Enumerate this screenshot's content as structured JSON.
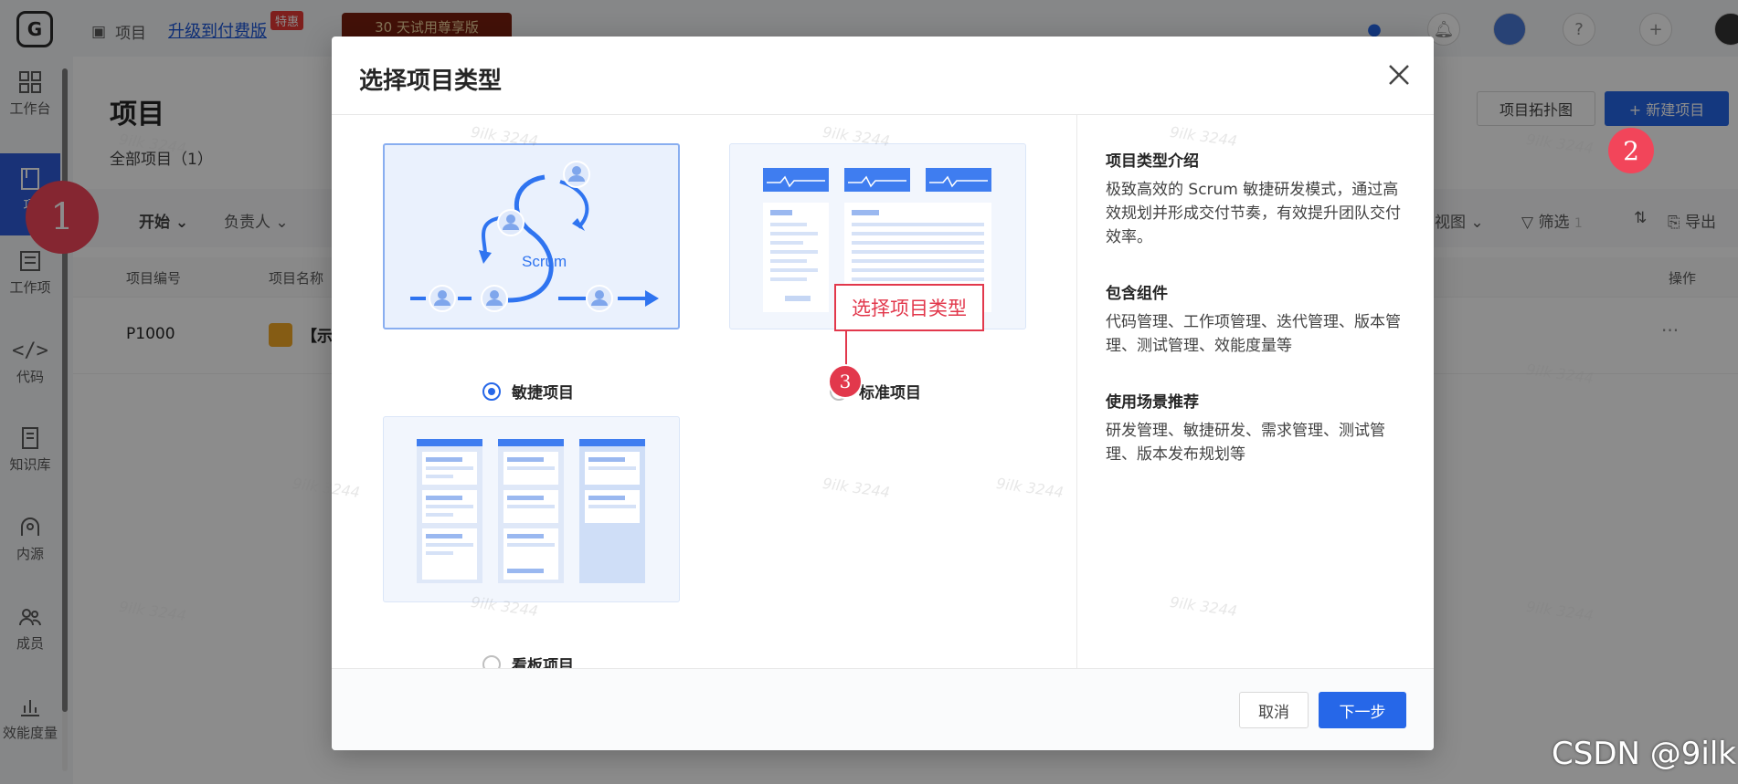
{
  "topbar": {
    "logo": "G",
    "breadcrumb": "项目",
    "upgrade_link": "升级到付费版",
    "special_badge": "特惠",
    "trial_banner": "30 天试用尊享版"
  },
  "sidebar": {
    "items": [
      {
        "label": "工作台",
        "icon": "grid-icon"
      },
      {
        "label": "项",
        "icon": "book-icon"
      },
      {
        "label": "工作项",
        "icon": "list-icon"
      },
      {
        "label": "代码",
        "icon": "code-icon"
      },
      {
        "label": "知识库",
        "icon": "doc-icon"
      },
      {
        "label": "内源",
        "icon": "source-icon"
      },
      {
        "label": "成员",
        "icon": "members-icon"
      },
      {
        "label": "效能度量",
        "icon": "chart-icon"
      }
    ]
  },
  "main": {
    "title": "项目",
    "all_projects": "全部项目（1）",
    "topology_button": "项目拓扑图",
    "new_project_button": "+ 新建项目",
    "filters": {
      "start": "开始",
      "owner": "负责人",
      "view": "视图",
      "filter": "筛选",
      "filter_count": "1",
      "export": "导出"
    },
    "columns": [
      "项目编号",
      "项目名称",
      "操作"
    ],
    "rows": [
      {
        "id": "P1000",
        "name": "【示"
      }
    ]
  },
  "modal": {
    "title": "选择项目类型",
    "options": [
      {
        "label": "敏捷项目",
        "checked": true,
        "illustration": "Scrum"
      },
      {
        "label": "标准项目",
        "checked": false
      },
      {
        "label": "看板项目",
        "checked": false
      }
    ],
    "sections": [
      {
        "title": "项目类型介绍",
        "text": "极致高效的 Scrum 敏捷研发模式，通过高效规划并形成交付节奏，有效提升团队交付效率。"
      },
      {
        "title": "包含组件",
        "text": "代码管理、工作项管理、迭代管理、版本管理、测试管理、效能度量等"
      },
      {
        "title": "使用场景推荐",
        "text": "研发管理、敏捷研发、需求管理、测试管理、版本发布规划等"
      }
    ],
    "cancel_button": "取消",
    "next_button": "下一步"
  },
  "annotations": {
    "step1": "1",
    "step2": "2",
    "step3": "3",
    "callout": "选择项目类型",
    "watermark": "9ilk 3244",
    "credit": "CSDN @9ilk"
  },
  "colors": {
    "primary": "#2667e8",
    "annotation": "#f2455a",
    "sidebar_active": "#2f5bd9"
  }
}
